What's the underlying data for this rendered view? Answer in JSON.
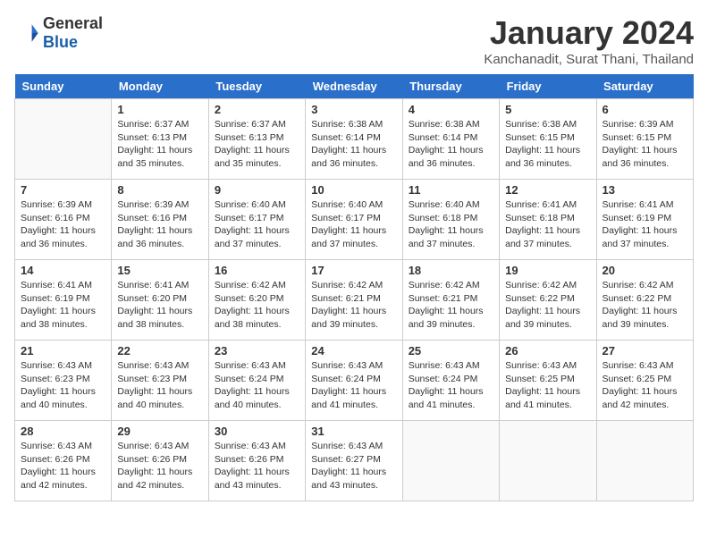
{
  "header": {
    "logo_general": "General",
    "logo_blue": "Blue",
    "month_title": "January 2024",
    "subtitle": "Kanchanadit, Surat Thani, Thailand"
  },
  "days_of_week": [
    "Sunday",
    "Monday",
    "Tuesday",
    "Wednesday",
    "Thursday",
    "Friday",
    "Saturday"
  ],
  "weeks": [
    [
      {
        "day": "",
        "info": ""
      },
      {
        "day": "1",
        "info": "Sunrise: 6:37 AM\nSunset: 6:13 PM\nDaylight: 11 hours\nand 35 minutes."
      },
      {
        "day": "2",
        "info": "Sunrise: 6:37 AM\nSunset: 6:13 PM\nDaylight: 11 hours\nand 35 minutes."
      },
      {
        "day": "3",
        "info": "Sunrise: 6:38 AM\nSunset: 6:14 PM\nDaylight: 11 hours\nand 36 minutes."
      },
      {
        "day": "4",
        "info": "Sunrise: 6:38 AM\nSunset: 6:14 PM\nDaylight: 11 hours\nand 36 minutes."
      },
      {
        "day": "5",
        "info": "Sunrise: 6:38 AM\nSunset: 6:15 PM\nDaylight: 11 hours\nand 36 minutes."
      },
      {
        "day": "6",
        "info": "Sunrise: 6:39 AM\nSunset: 6:15 PM\nDaylight: 11 hours\nand 36 minutes."
      }
    ],
    [
      {
        "day": "7",
        "info": "Sunrise: 6:39 AM\nSunset: 6:16 PM\nDaylight: 11 hours\nand 36 minutes."
      },
      {
        "day": "8",
        "info": "Sunrise: 6:39 AM\nSunset: 6:16 PM\nDaylight: 11 hours\nand 36 minutes."
      },
      {
        "day": "9",
        "info": "Sunrise: 6:40 AM\nSunset: 6:17 PM\nDaylight: 11 hours\nand 37 minutes."
      },
      {
        "day": "10",
        "info": "Sunrise: 6:40 AM\nSunset: 6:17 PM\nDaylight: 11 hours\nand 37 minutes."
      },
      {
        "day": "11",
        "info": "Sunrise: 6:40 AM\nSunset: 6:18 PM\nDaylight: 11 hours\nand 37 minutes."
      },
      {
        "day": "12",
        "info": "Sunrise: 6:41 AM\nSunset: 6:18 PM\nDaylight: 11 hours\nand 37 minutes."
      },
      {
        "day": "13",
        "info": "Sunrise: 6:41 AM\nSunset: 6:19 PM\nDaylight: 11 hours\nand 37 minutes."
      }
    ],
    [
      {
        "day": "14",
        "info": "Sunrise: 6:41 AM\nSunset: 6:19 PM\nDaylight: 11 hours\nand 38 minutes."
      },
      {
        "day": "15",
        "info": "Sunrise: 6:41 AM\nSunset: 6:20 PM\nDaylight: 11 hours\nand 38 minutes."
      },
      {
        "day": "16",
        "info": "Sunrise: 6:42 AM\nSunset: 6:20 PM\nDaylight: 11 hours\nand 38 minutes."
      },
      {
        "day": "17",
        "info": "Sunrise: 6:42 AM\nSunset: 6:21 PM\nDaylight: 11 hours\nand 39 minutes."
      },
      {
        "day": "18",
        "info": "Sunrise: 6:42 AM\nSunset: 6:21 PM\nDaylight: 11 hours\nand 39 minutes."
      },
      {
        "day": "19",
        "info": "Sunrise: 6:42 AM\nSunset: 6:22 PM\nDaylight: 11 hours\nand 39 minutes."
      },
      {
        "day": "20",
        "info": "Sunrise: 6:42 AM\nSunset: 6:22 PM\nDaylight: 11 hours\nand 39 minutes."
      }
    ],
    [
      {
        "day": "21",
        "info": "Sunrise: 6:43 AM\nSunset: 6:23 PM\nDaylight: 11 hours\nand 40 minutes."
      },
      {
        "day": "22",
        "info": "Sunrise: 6:43 AM\nSunset: 6:23 PM\nDaylight: 11 hours\nand 40 minutes."
      },
      {
        "day": "23",
        "info": "Sunrise: 6:43 AM\nSunset: 6:24 PM\nDaylight: 11 hours\nand 40 minutes."
      },
      {
        "day": "24",
        "info": "Sunrise: 6:43 AM\nSunset: 6:24 PM\nDaylight: 11 hours\nand 41 minutes."
      },
      {
        "day": "25",
        "info": "Sunrise: 6:43 AM\nSunset: 6:24 PM\nDaylight: 11 hours\nand 41 minutes."
      },
      {
        "day": "26",
        "info": "Sunrise: 6:43 AM\nSunset: 6:25 PM\nDaylight: 11 hours\nand 41 minutes."
      },
      {
        "day": "27",
        "info": "Sunrise: 6:43 AM\nSunset: 6:25 PM\nDaylight: 11 hours\nand 42 minutes."
      }
    ],
    [
      {
        "day": "28",
        "info": "Sunrise: 6:43 AM\nSunset: 6:26 PM\nDaylight: 11 hours\nand 42 minutes."
      },
      {
        "day": "29",
        "info": "Sunrise: 6:43 AM\nSunset: 6:26 PM\nDaylight: 11 hours\nand 42 minutes."
      },
      {
        "day": "30",
        "info": "Sunrise: 6:43 AM\nSunset: 6:26 PM\nDaylight: 11 hours\nand 43 minutes."
      },
      {
        "day": "31",
        "info": "Sunrise: 6:43 AM\nSunset: 6:27 PM\nDaylight: 11 hours\nand 43 minutes."
      },
      {
        "day": "",
        "info": ""
      },
      {
        "day": "",
        "info": ""
      },
      {
        "day": "",
        "info": ""
      }
    ]
  ]
}
